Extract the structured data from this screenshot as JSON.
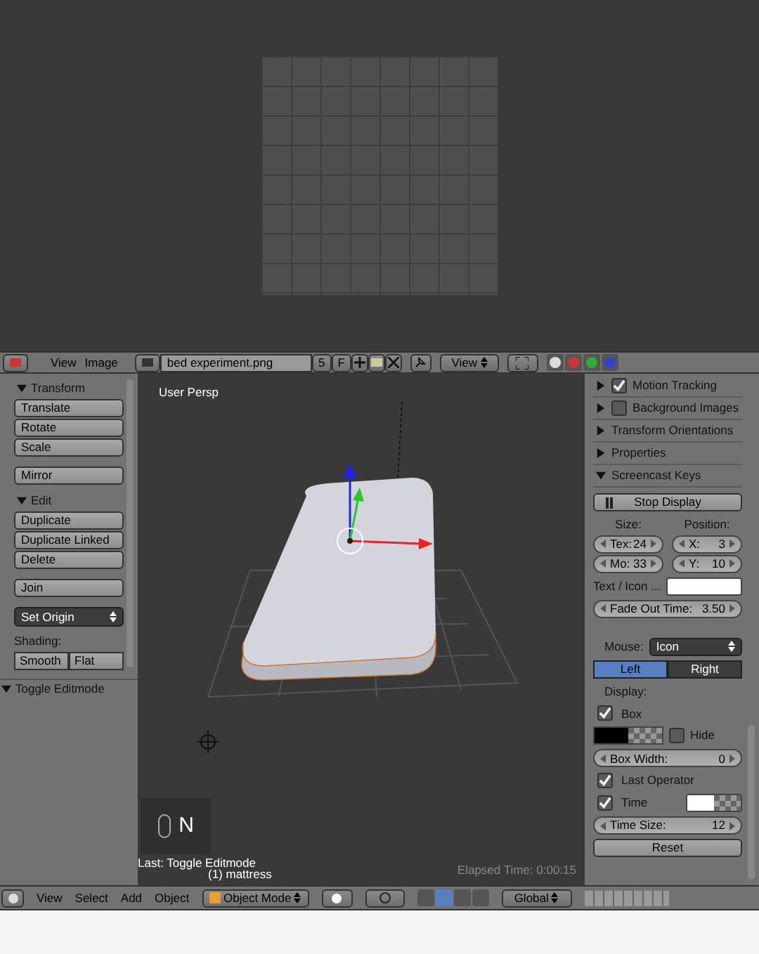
{
  "image_editor": {
    "menus": [
      "View",
      "Image"
    ],
    "image_name": "bed experiment.png",
    "users": "5",
    "fake_user": "F",
    "view_mode": "View"
  },
  "toolshelf": {
    "panels": [
      {
        "title": "Transform",
        "expanded": true,
        "items": [
          {
            "kind": "button",
            "label": "Translate"
          },
          {
            "kind": "button",
            "label": "Rotate"
          },
          {
            "kind": "button",
            "label": "Scale"
          },
          {
            "kind": "gap"
          },
          {
            "kind": "button",
            "label": "Mirror"
          }
        ]
      },
      {
        "title": "Edit",
        "expanded": true,
        "items": [
          {
            "kind": "button",
            "label": "Duplicate"
          },
          {
            "kind": "button",
            "label": "Duplicate Linked"
          },
          {
            "kind": "button",
            "label": "Delete"
          },
          {
            "kind": "gap"
          },
          {
            "kind": "button",
            "label": "Join"
          },
          {
            "kind": "gap"
          },
          {
            "kind": "dropdown",
            "label": "Set Origin"
          },
          {
            "kind": "label",
            "label": "Shading:"
          },
          {
            "kind": "pair",
            "labels": [
              "Smooth",
              "Flat"
            ]
          }
        ]
      }
    ],
    "operator": {
      "title": "Toggle Editmode",
      "expanded": true
    }
  },
  "viewport": {
    "view_label": "User Persp",
    "key": "N",
    "last_operator": "Last: Toggle Editmode",
    "object_label": "(1) mattress",
    "elapsed": "Elapsed Time: 0:00:15"
  },
  "properties": {
    "panels": [
      {
        "title": "Motion Tracking",
        "expanded": false,
        "checked": true
      },
      {
        "title": "Background Images",
        "expanded": false,
        "checked": false
      },
      {
        "title": "Transform Orientations",
        "expanded": false
      },
      {
        "title": "Properties",
        "expanded": false
      },
      {
        "title": "Screencast Keys",
        "expanded": true
      }
    ],
    "screencast": [
      {
        "kind": "button",
        "label": "Stop Display"
      },
      {
        "kind": "size_position",
        "size_label": "Size:",
        "position_label": "Position:",
        "size": [
          {
            "label": "Tex:",
            "value": "24"
          },
          {
            "label": "Mo:",
            "value": "33"
          }
        ],
        "position": [
          {
            "label": "X:",
            "value": "3"
          },
          {
            "label": "Y:",
            "value": "10"
          }
        ]
      },
      {
        "kind": "color",
        "label": "Text / Icon ..."
      },
      {
        "kind": "number",
        "label": "Fade Out Time:",
        "value": "3.50"
      },
      {
        "kind": "gap"
      },
      {
        "kind": "dropdown",
        "label": "Mouse:",
        "value": "Icon"
      },
      {
        "kind": "toggle",
        "options": [
          {
            "label": "Left",
            "selected": true
          },
          {
            "label": "Right",
            "selected": false
          }
        ]
      },
      {
        "kind": "label",
        "label": "Display:"
      },
      {
        "kind": "checkbox",
        "label": "Box",
        "checked": true
      },
      {
        "kind": "color_hide",
        "label": "Hide",
        "checked": false
      },
      {
        "kind": "number",
        "label": "Box Width:",
        "value": "0"
      },
      {
        "kind": "checkbox",
        "label": "Last Operator",
        "checked": true
      },
      {
        "kind": "checkbox_color",
        "label": "Time",
        "checked": true
      },
      {
        "kind": "number",
        "label": "Time Size:",
        "value": "12"
      },
      {
        "kind": "button",
        "label": "Reset"
      }
    ]
  },
  "footer": {
    "menus": [
      "View",
      "Select",
      "Add",
      "Object"
    ],
    "mode": "Object Mode",
    "orientation": "Global"
  }
}
